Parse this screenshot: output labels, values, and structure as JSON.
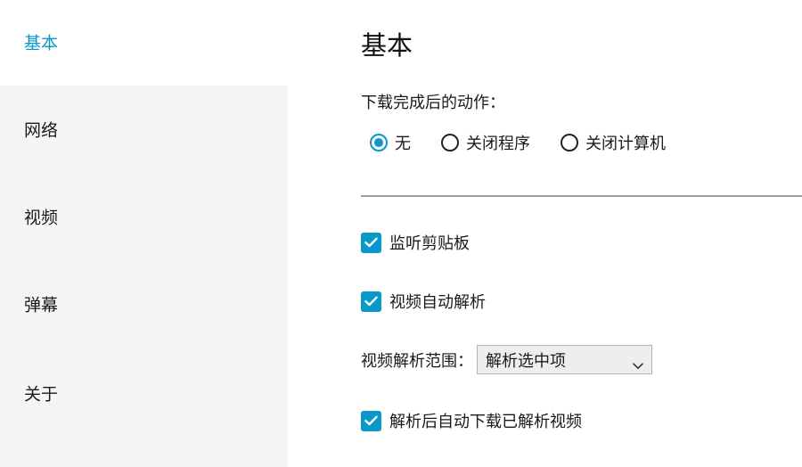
{
  "sidebar": {
    "items": [
      {
        "label": "基本",
        "active": true
      },
      {
        "label": "网络",
        "active": false
      },
      {
        "label": "视频",
        "active": false
      },
      {
        "label": "弹幕",
        "active": false
      },
      {
        "label": "关于",
        "active": false
      }
    ]
  },
  "main": {
    "title": "基本",
    "after_download": {
      "label": "下载完成后的动作：",
      "options": [
        "无",
        "关闭程序",
        "关闭计算机"
      ],
      "selected": "无"
    },
    "clipboard": {
      "label": "监听剪贴板",
      "checked": true
    },
    "auto_parse": {
      "label": "视频自动解析",
      "checked": true
    },
    "parse_range": {
      "label": "视频解析范围：",
      "value": "解析选中项"
    },
    "auto_download": {
      "label": "解析后自动下载已解析视频",
      "checked": true
    }
  },
  "colors": {
    "accent": "#0a98c9",
    "sidebar_bg": "#f5f5f5",
    "divider": "#a0a0a0"
  },
  "icons": {
    "checkbox": "check-icon",
    "dropdown": "chevron-down-icon"
  }
}
